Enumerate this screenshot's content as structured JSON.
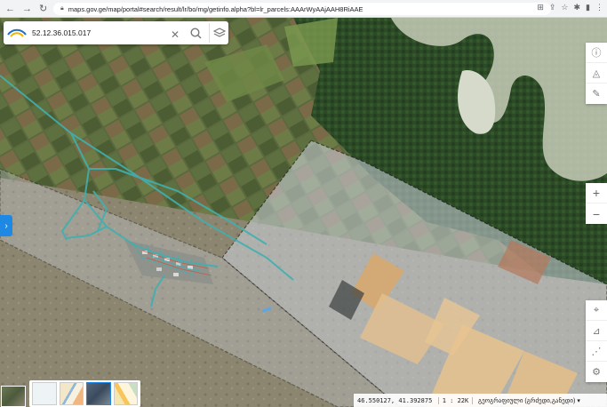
{
  "browser": {
    "url": "maps.gov.ge/map/portal#search/result/lr/bo/mg/getinfo.alpha?bl=lr_parcels:AAArWyAAjAAH8RiAAE"
  },
  "search": {
    "value": "52.12.36.015.017"
  },
  "status": {
    "coordinates": "46.550127, 41.392875",
    "scale": "1 : 22K",
    "projection": "გეოგრაფიული (გრძედი,განედი)"
  },
  "colors": {
    "accent": "#1e88e5",
    "parcel_line": "#3fb0b0",
    "cadastral_overlay": "#d8dde8"
  }
}
